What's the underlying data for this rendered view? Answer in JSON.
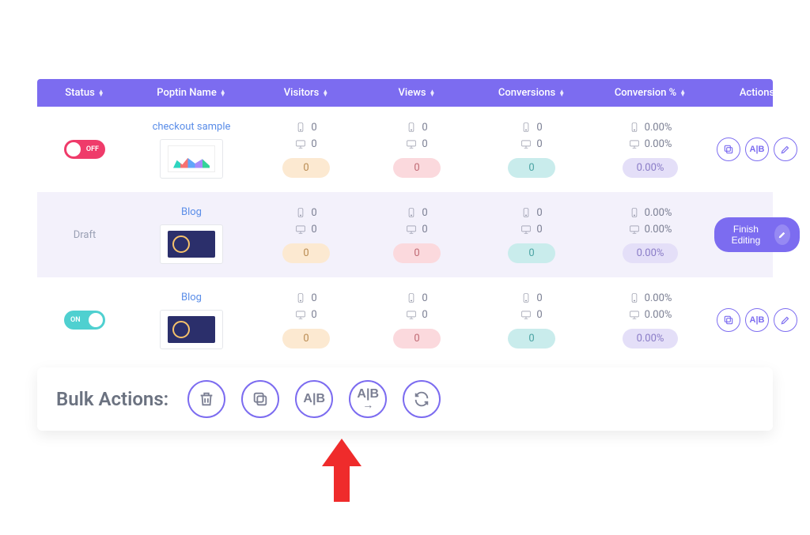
{
  "headers": {
    "status": "Status",
    "name": "Poptin Name",
    "visitors": "Visitors",
    "views": "Views",
    "conversions": "Conversions",
    "conv_pct": "Conversion %",
    "actions": "Actions"
  },
  "toggle_labels": {
    "on": "ON",
    "off": "OFF"
  },
  "rows": [
    {
      "status": "off",
      "name": "checkout sample",
      "thumb": "chart",
      "visitors": {
        "mobile": "0",
        "desktop": "0",
        "total": "0"
      },
      "views": {
        "mobile": "0",
        "desktop": "0",
        "total": "0"
      },
      "conversions": {
        "mobile": "0",
        "desktop": "0",
        "total": "0"
      },
      "conv_pct": {
        "mobile": "0.00%",
        "desktop": "0.00%",
        "total": "0.00%"
      },
      "action_set": "standard"
    },
    {
      "status": "draft",
      "status_label": "Draft",
      "name": "Blog",
      "thumb": "dark",
      "visitors": {
        "mobile": "0",
        "desktop": "0",
        "total": "0"
      },
      "views": {
        "mobile": "0",
        "desktop": "0",
        "total": "0"
      },
      "conversions": {
        "mobile": "0",
        "desktop": "0",
        "total": "0"
      },
      "conv_pct": {
        "mobile": "0.00%",
        "desktop": "0.00%",
        "total": "0.00%"
      },
      "action_set": "finish"
    },
    {
      "status": "on",
      "name": "Blog",
      "thumb": "dark",
      "visitors": {
        "mobile": "0",
        "desktop": "0",
        "total": "0"
      },
      "views": {
        "mobile": "0",
        "desktop": "0",
        "total": "0"
      },
      "conversions": {
        "mobile": "0",
        "desktop": "0",
        "total": "0"
      },
      "conv_pct": {
        "mobile": "0.00%",
        "desktop": "0.00%",
        "total": "0.00%"
      },
      "action_set": "standard"
    }
  ],
  "row_actions": {
    "duplicate": "duplicate",
    "ab": "A|B",
    "edit": "edit",
    "finish_editing": "Finish Editing"
  },
  "bulk": {
    "title": "Bulk Actions:",
    "delete": "delete",
    "duplicate": "duplicate",
    "ab": "A|B",
    "ab_move": "A|B",
    "refresh": "refresh"
  }
}
